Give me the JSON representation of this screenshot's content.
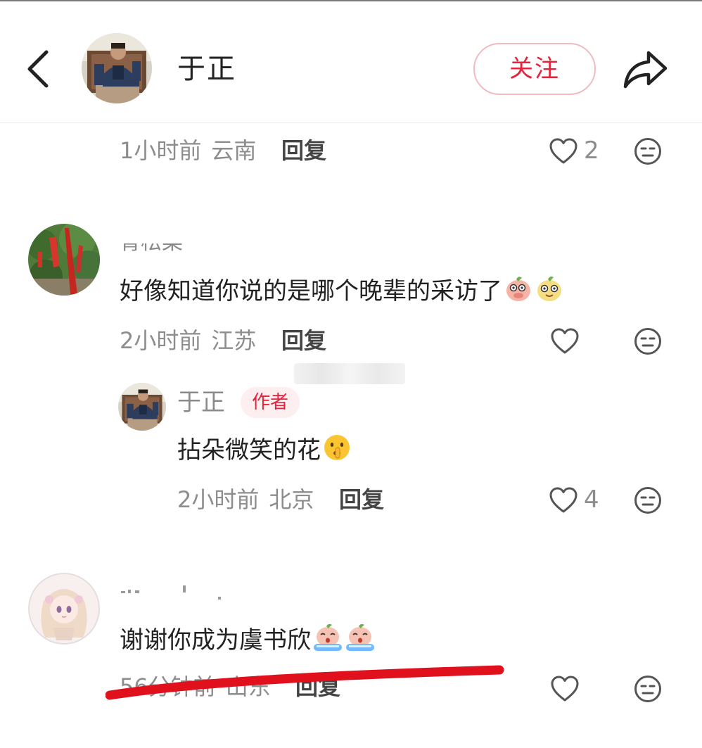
{
  "header": {
    "username": "于正",
    "follow_label": "关注"
  },
  "top_meta": {
    "time": "1小时前",
    "location": "云南",
    "reply_label": "回复",
    "likes": "2"
  },
  "comments": [
    {
      "username": "青松菜",
      "content": "好像知道你说的是哪个晚辈的采访了",
      "time": "2小时前",
      "location": "江苏",
      "reply_label": "回复",
      "likes": "",
      "replies": [
        {
          "username": "于正",
          "author_tag": "作者",
          "content": "拈朵微笑的花",
          "time": "2小时前",
          "location": "北京",
          "reply_label": "回复",
          "likes": "4"
        }
      ]
    },
    {
      "username": "",
      "content": "谢谢你成为虞书欣",
      "time": "56分钟前",
      "location": "山东",
      "reply_label": "回复",
      "likes": ""
    }
  ],
  "colors": {
    "accent": "#e6233d",
    "annotation_stroke": "#e0111d"
  },
  "icons": {
    "back": "chevron-left-icon",
    "share": "share-arrow-icon",
    "like": "heart-outline-icon",
    "dislike": "neutral-face-icon"
  }
}
